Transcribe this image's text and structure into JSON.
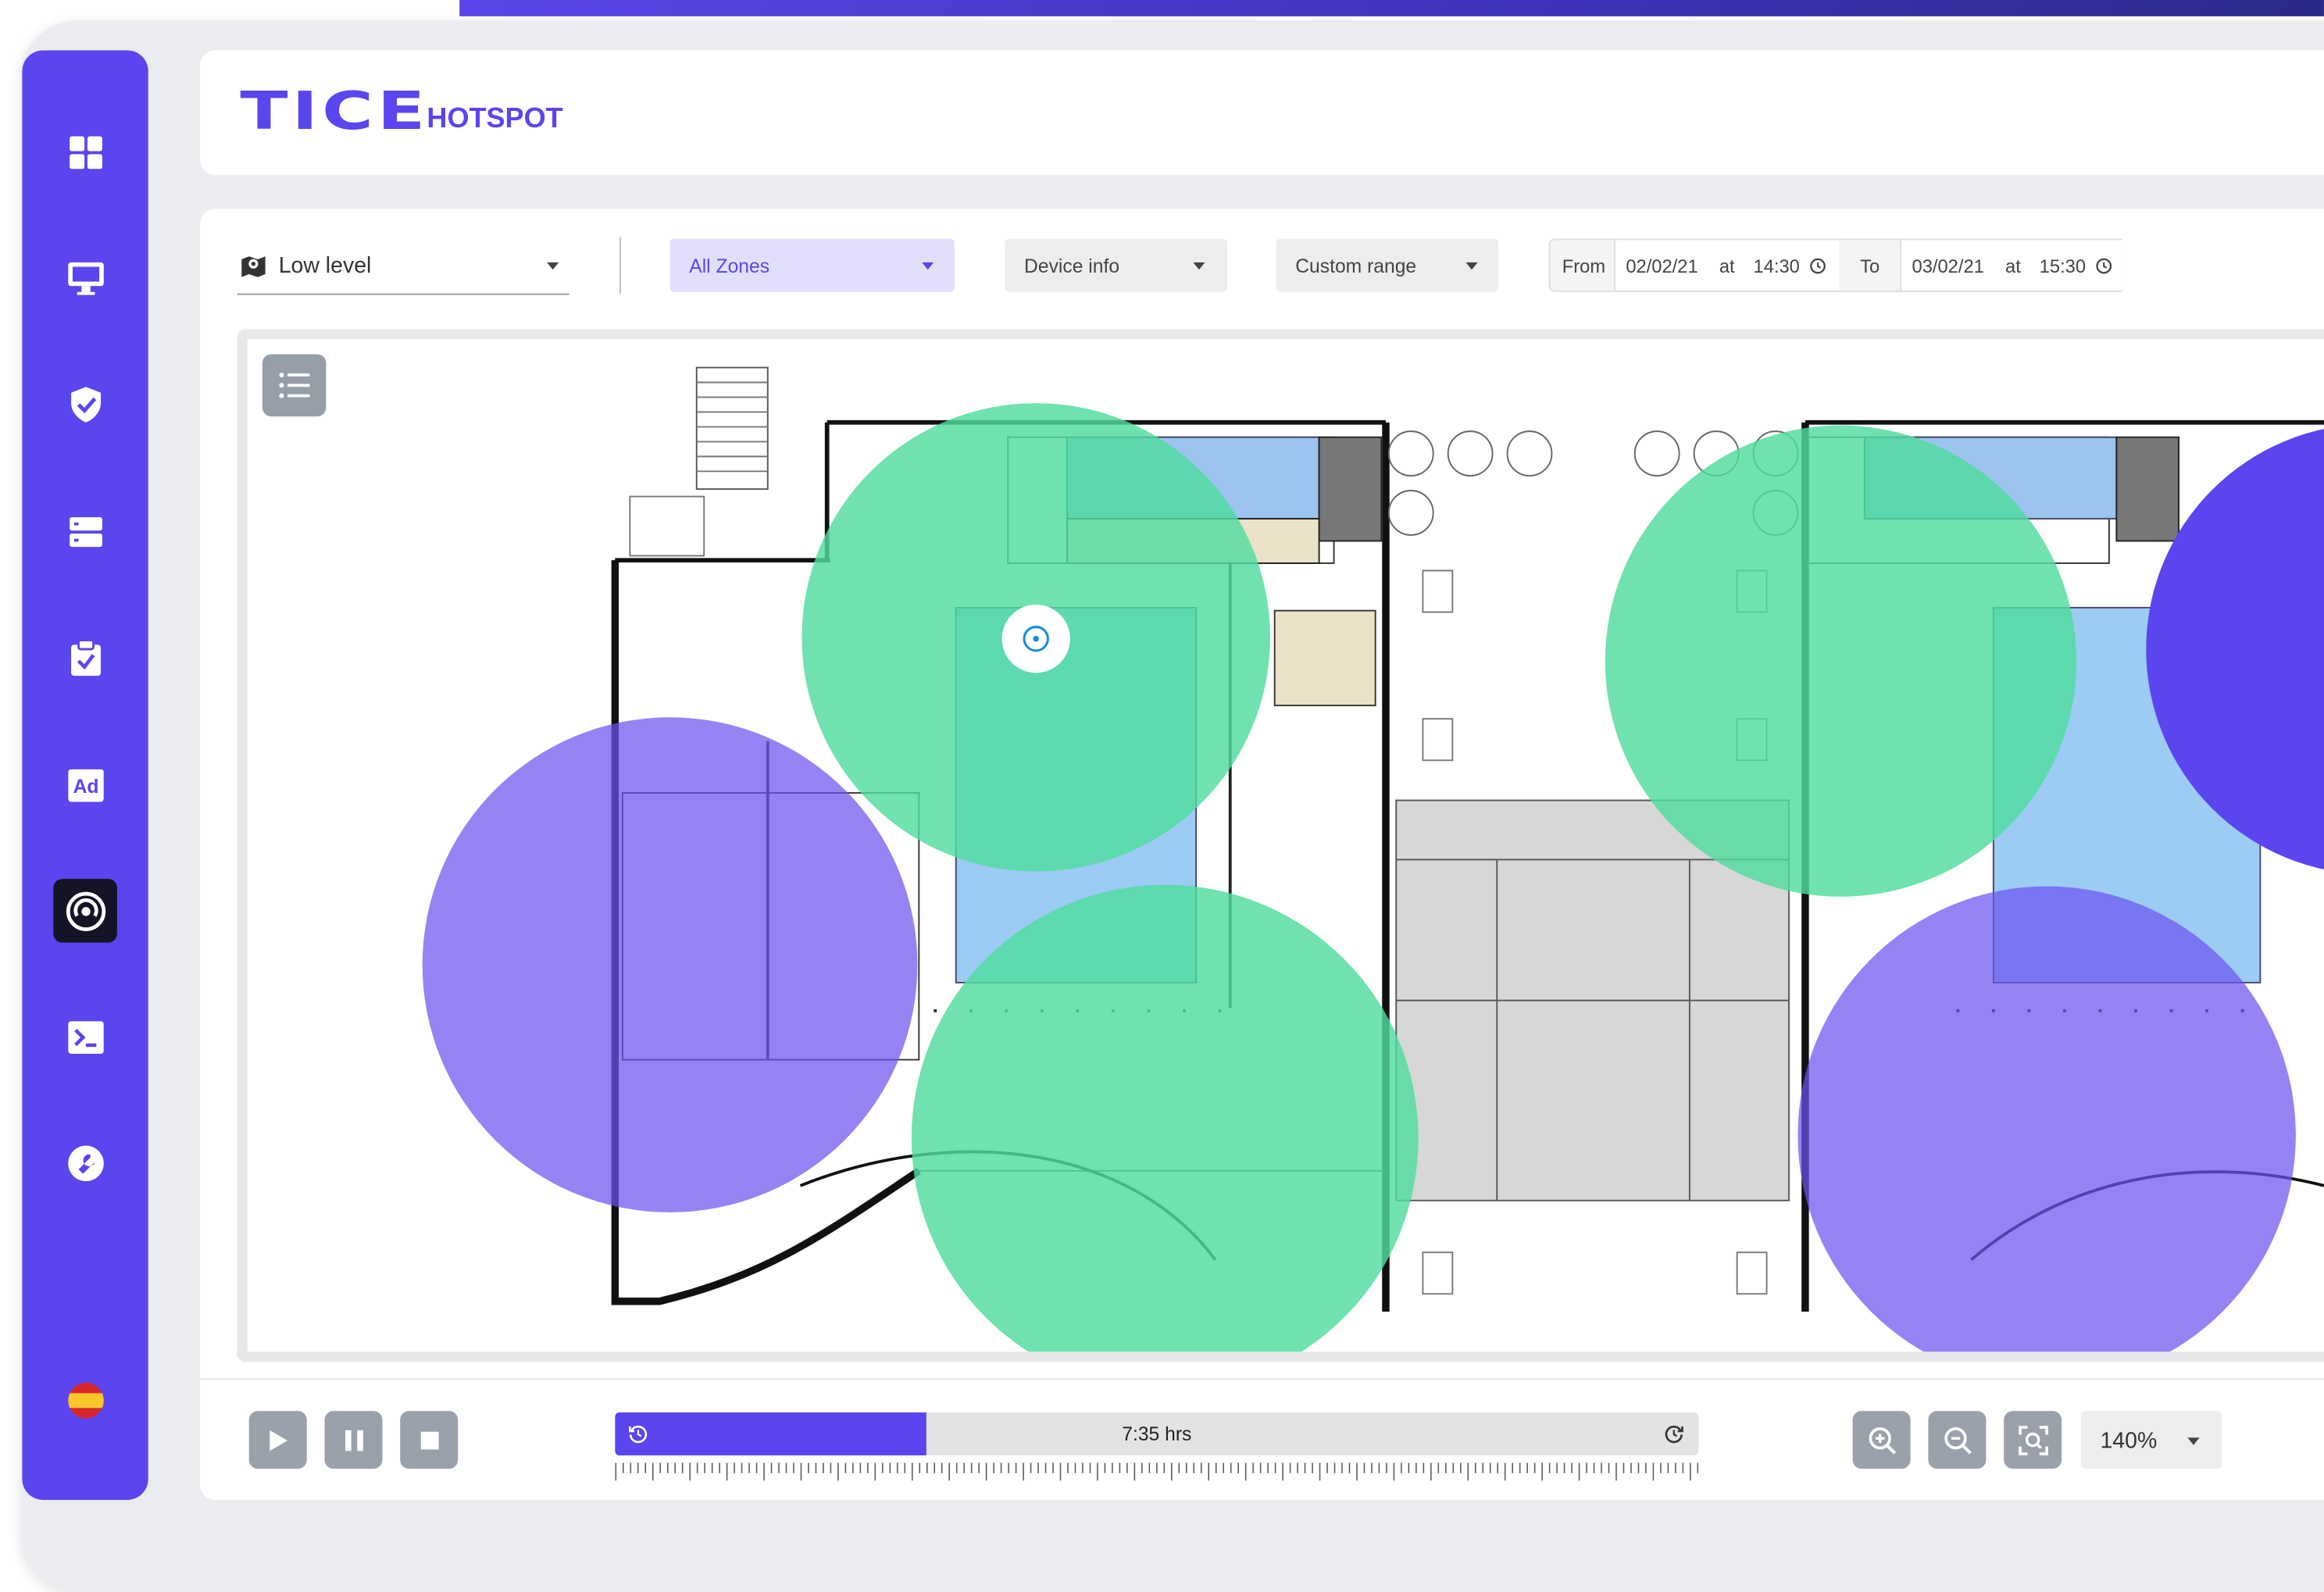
{
  "app": {
    "logo_main": "TICE",
    "logo_sub": "HOTSPOT"
  },
  "sidebar": {
    "items": [
      {
        "icon": "dashboard-grid-icon",
        "active": false
      },
      {
        "icon": "monitor-icon",
        "active": false
      },
      {
        "icon": "shield-check-icon",
        "active": false
      },
      {
        "icon": "server-icon",
        "active": false
      },
      {
        "icon": "clipboard-check-icon",
        "active": false
      },
      {
        "icon": "ad-icon",
        "active": false
      },
      {
        "icon": "hotspot-signal-icon",
        "active": true
      },
      {
        "icon": "terminal-icon",
        "active": false
      },
      {
        "icon": "wrench-icon",
        "active": false
      }
    ],
    "language_flag": "spain-flag-icon"
  },
  "filters": {
    "level": "Low level",
    "zones": "All Zones",
    "device": "Device info",
    "range": "Custom range",
    "from_label": "From",
    "from_date": "02/02/21",
    "from_at": "at",
    "from_time": "14:30",
    "to_label": "To",
    "to_date": "03/02/21",
    "to_at": "at",
    "to_time": "15:30"
  },
  "playback": {
    "duration_label": "7:35 hrs",
    "progress": 0.287
  },
  "zoom": {
    "level": "140%"
  },
  "colors": {
    "brand": "#5b45ee",
    "heat_high": "#4fdc9f",
    "heat_low": "#6b54ef",
    "controls": "#9aa1aa"
  }
}
